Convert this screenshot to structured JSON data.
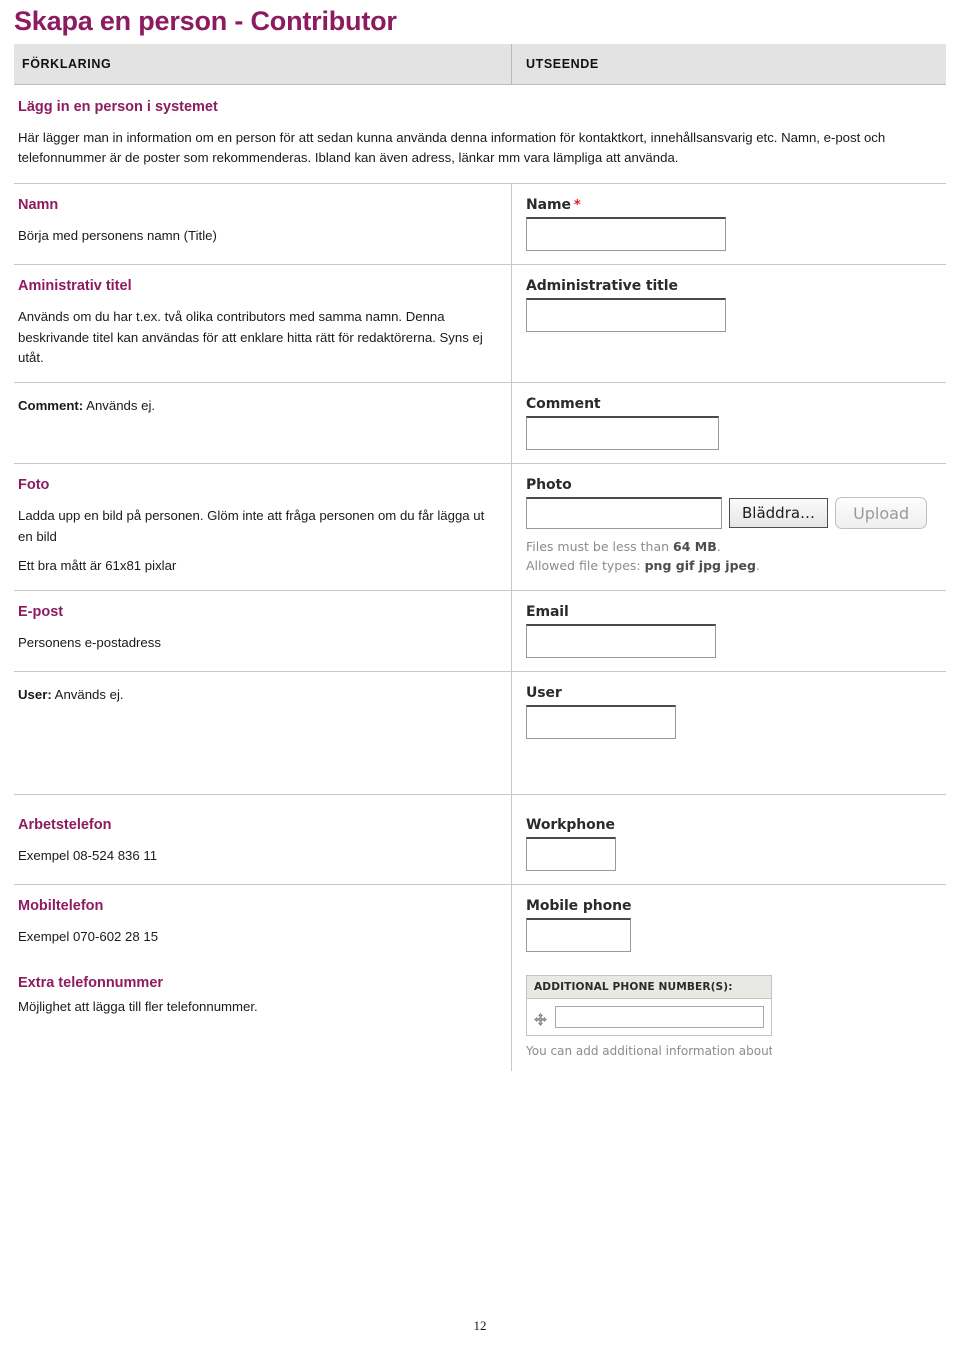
{
  "document": {
    "title": "Skapa en person - Contributor",
    "page_number": "12"
  },
  "table_header": {
    "left": "FÖRKLARING",
    "right": "UTSEENDE"
  },
  "sections": {
    "intro": {
      "heading": "Lägg in en person i systemet",
      "paragraph": "Här lägger man in information om en person för att sedan kunna använda denna information för kontaktkort, innehållsansvarig etc.  Namn, e-post och telefonnummer är de poster som rekommenderas. Ibland kan även adress, länkar mm vara lämpliga att använda."
    },
    "namn": {
      "heading": "Namn",
      "paragraph": "Börja med personens namn (Title)",
      "field_label": "Name",
      "required_mark": "*"
    },
    "administrativ_titel": {
      "heading": "Aministrativ titel",
      "paragraph": "Används om du har t.ex. två olika contributors med samma namn. Denna beskrivande titel kan användas för att enklare hitta rätt för redaktörerna. Syns ej utåt.",
      "field_label": "Administrative title"
    },
    "comment": {
      "note_prefix": "Comment:",
      "note_text": " Används ej.",
      "field_label": "Comment"
    },
    "foto": {
      "heading": "Foto",
      "paragraph_1": "Ladda upp en bild på personen. Glöm inte att fråga personen om du får lägga ut en bild",
      "paragraph_2": "Ett bra mått är 61x81 pixlar",
      "field_label": "Photo",
      "browse_button": "Bläddra…",
      "upload_button": "Upload",
      "help_size_prefix": "Files must be less than ",
      "help_size_value": "64 MB",
      "help_size_suffix": ".",
      "help_types_prefix": "Allowed file types: ",
      "help_types_value": "png gif jpg jpeg",
      "help_types_suffix": "."
    },
    "epost": {
      "heading": "E-post",
      "paragraph": "Personens e-postadress",
      "field_label": "Email"
    },
    "user": {
      "note_prefix": "User:",
      "note_text": "  Används ej.",
      "field_label": "User"
    },
    "arbetstelefon": {
      "heading": "Arbetstelefon",
      "paragraph": "Exempel  08-524 836 11",
      "field_label": "Workphone"
    },
    "mobiltelefon": {
      "heading": "Mobiltelefon",
      "paragraph": "Exempel 070-602 28 15",
      "field_label": "Mobile phone"
    },
    "extra_telefonnummer": {
      "heading": "Extra telefonnummer",
      "paragraph": "Möjlighet att lägga till fler telefonnummer.",
      "widget_header": "ADDITIONAL PHONE NUMBER(S):",
      "widget_help": "You can add additional information about th"
    }
  },
  "colors": {
    "accent": "#8d1b60",
    "required": "#d81e24",
    "header_band": "#e3e3e3",
    "rule": "#c8c8c8"
  }
}
